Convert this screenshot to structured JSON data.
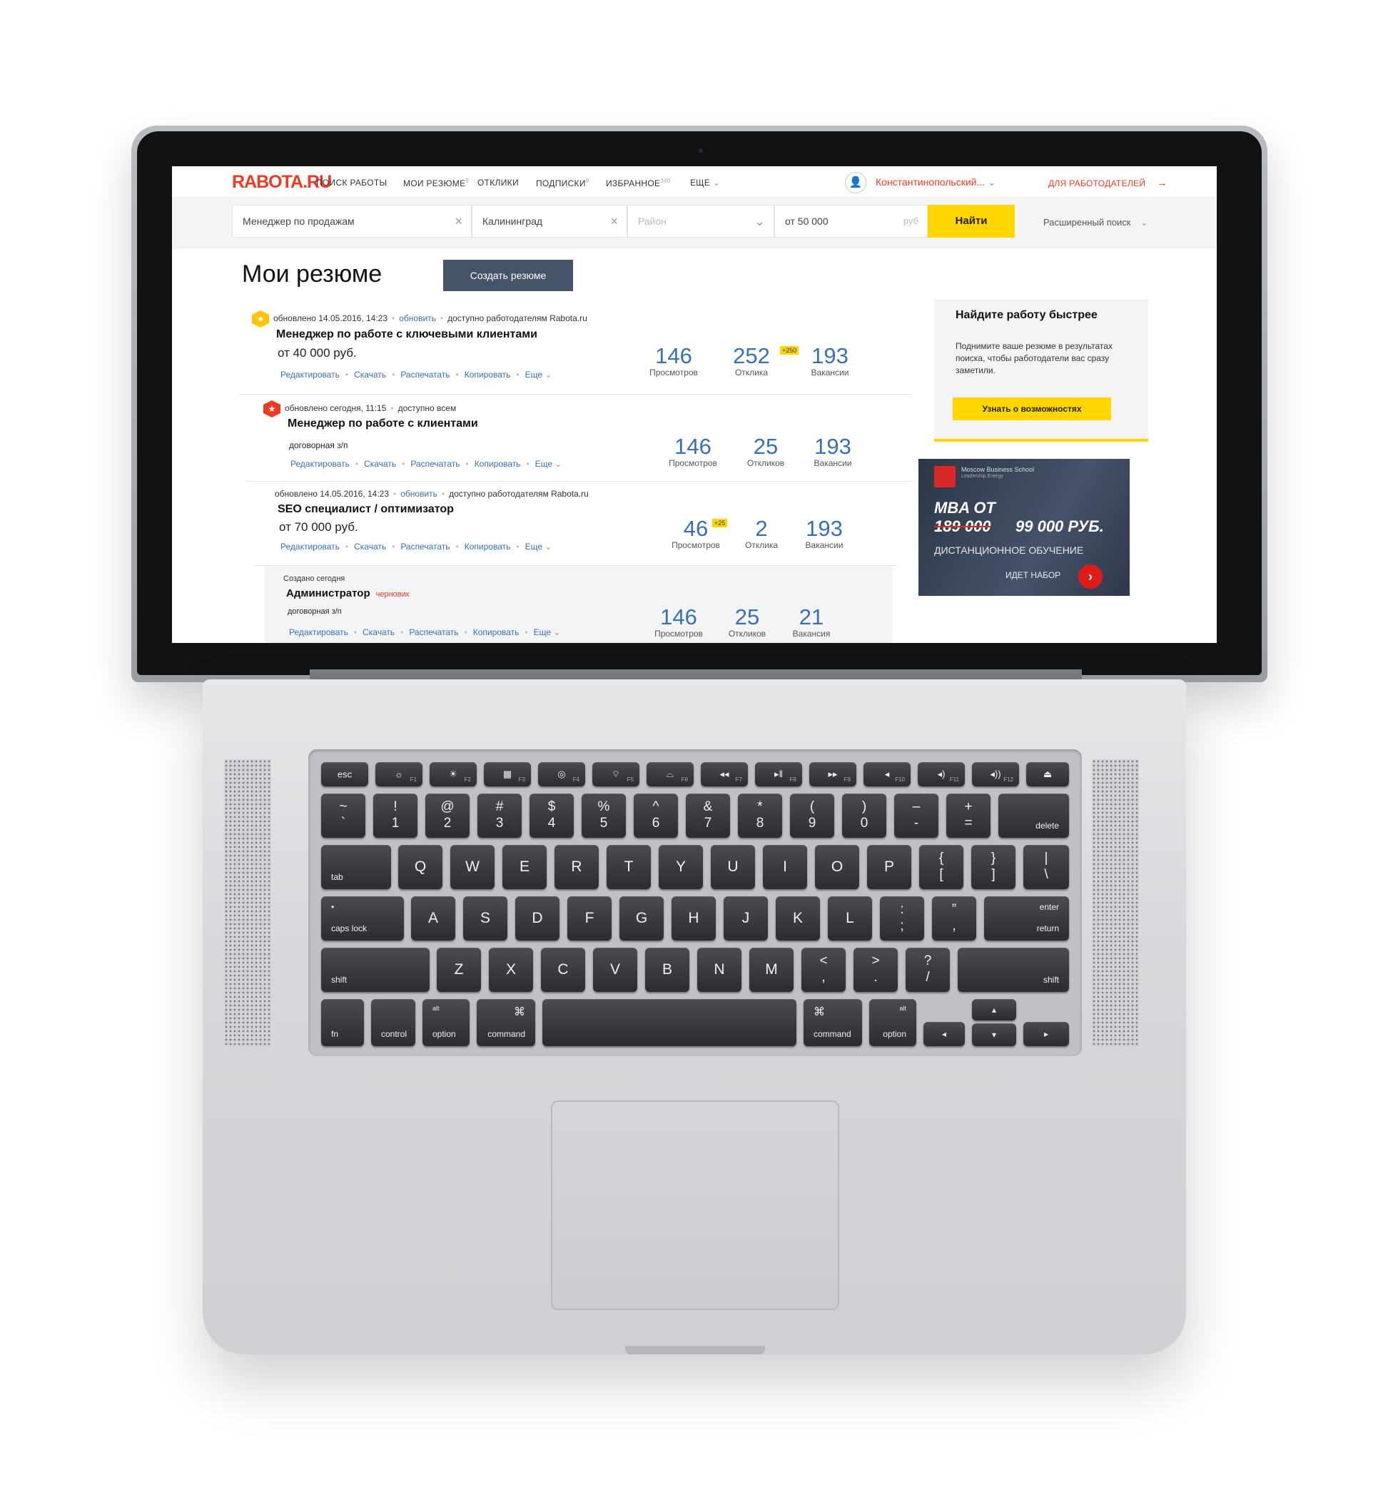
{
  "site": {
    "logo": "RABOTA.RU",
    "nav": [
      {
        "label": "ПОИСК РАБОТЫ",
        "count": ""
      },
      {
        "label": "МОИ РЕЗЮМЕ",
        "count": "9"
      },
      {
        "label": "ОТКЛИКИ",
        "count": ""
      },
      {
        "label": "ПОДПИСКИ",
        "count": "9"
      },
      {
        "label": "ИЗБРАННОЕ",
        "count": "340"
      },
      {
        "label": "ЕЩЕ",
        "count": ""
      }
    ],
    "user_name": "Константинопольский...",
    "employers_link": "ДЛЯ РАБОТОДАТЕЛЕЙ"
  },
  "search": {
    "query": "Менеджер по продажам",
    "city": "Калининград",
    "district_placeholder": "Район",
    "salary_from": "от 50 000",
    "currency": "руб",
    "find_button": "Найти",
    "advanced": "Расширенный поиск"
  },
  "page": {
    "title": "Мои резюме",
    "create_button": "Создать резюме"
  },
  "action_labels": [
    "Редактировать",
    "Скачать",
    "Распечатать",
    "Копировать",
    "Еще"
  ],
  "resumes": [
    {
      "status": "обновлено 14.05.2016, 14:23",
      "refresh": "обновить",
      "visibility": "доступно работодателям Rabota.ru",
      "title": "Менеджер по работе с ключевыми клиентами",
      "salary": "от 40 000 руб.",
      "stats": [
        {
          "value": "146",
          "label": "Просмотров",
          "badge": ""
        },
        {
          "value": "252",
          "label": "Отклика",
          "badge": "+250"
        },
        {
          "value": "193",
          "label": "Вакансии",
          "badge": ""
        }
      ]
    },
    {
      "status": "обновлено сегодня, 11:15",
      "refresh": "",
      "visibility": "доступно всем",
      "title": "Менеджер по работе с клиентами",
      "salary": "договорная з/п",
      "stats": [
        {
          "value": "146",
          "label": "Просмотров",
          "badge": ""
        },
        {
          "value": "25",
          "label": "Откликов",
          "badge": ""
        },
        {
          "value": "193",
          "label": "Вакансии",
          "badge": ""
        }
      ]
    },
    {
      "status": "обновлено 14.05.2016, 14:23",
      "refresh": "обновить",
      "visibility": "доступно работодателям Rabota.ru",
      "title": "SEO специалист / оптимизатор",
      "salary": "от 70 000 руб.",
      "stats": [
        {
          "value": "46",
          "label": "Просмотров",
          "badge": "+25"
        },
        {
          "value": "2",
          "label": "Отклика",
          "badge": ""
        },
        {
          "value": "193",
          "label": "Вакансии",
          "badge": ""
        }
      ]
    },
    {
      "status": "Создано сегодня",
      "refresh": "",
      "visibility": "",
      "title": "Администратор",
      "draft": "черновик",
      "salary": "договорная з/п",
      "stats": [
        {
          "value": "146",
          "label": "Просмотров",
          "badge": ""
        },
        {
          "value": "25",
          "label": "Откликов",
          "badge": ""
        },
        {
          "value": "21",
          "label": "Вакансия",
          "badge": ""
        }
      ]
    }
  ],
  "promo": {
    "title": "Найдите работу быстрее",
    "text": "Поднимите ваше резюме в результатах поиска, чтобы работодатели вас сразу заметили.",
    "button": "Узнать о возможностях"
  },
  "ad": {
    "brand": "Moscow Business School",
    "brand_tag": "Leadership Energy",
    "line1": "MBA ОТ",
    "old_price": "189 000",
    "new_price": "99 000 РУБ.",
    "subtitle": "ДИСТАНЦИОННОЕ ОБУЧЕНИЕ",
    "cta": "ИДЕТ НАБОР"
  },
  "keyboard": {
    "fn_row": [
      {
        "icon": "esc",
        "f": ""
      },
      {
        "icon": "☼",
        "f": "F1"
      },
      {
        "icon": "☀",
        "f": "F2"
      },
      {
        "icon": "▦",
        "f": "F3"
      },
      {
        "icon": "◎",
        "f": "F4"
      },
      {
        "icon": "⌔",
        "f": "F5"
      },
      {
        "icon": "⌓",
        "f": "F6"
      },
      {
        "icon": "◂◂",
        "f": "F7"
      },
      {
        "icon": "▸‖",
        "f": "F8"
      },
      {
        "icon": "▸▸",
        "f": "F9"
      },
      {
        "icon": "◂",
        "f": "F10"
      },
      {
        "icon": "◂)",
        "f": "F11"
      },
      {
        "icon": "◂))",
        "f": "F12"
      },
      {
        "icon": "⏏",
        "f": ""
      }
    ],
    "num_row": [
      [
        "~",
        "`"
      ],
      [
        "!",
        "1"
      ],
      [
        "@",
        "2"
      ],
      [
        "#",
        "3"
      ],
      [
        "$",
        "4"
      ],
      [
        "%",
        "5"
      ],
      [
        "^",
        "6"
      ],
      [
        "&",
        "7"
      ],
      [
        "*",
        "8"
      ],
      [
        "(",
        "9"
      ],
      [
        ")",
        "0"
      ],
      [
        "–",
        "-"
      ],
      [
        "+",
        "="
      ]
    ],
    "delete": "delete",
    "tab": "tab",
    "q_row": [
      "Q",
      "W",
      "E",
      "R",
      "T",
      "Y",
      "U",
      "I",
      "O",
      "P"
    ],
    "q_row_extra": [
      [
        "{",
        "["
      ],
      [
        "}",
        "]"
      ],
      [
        "|",
        "\\"
      ]
    ],
    "caps": "caps lock",
    "a_row": [
      "A",
      "S",
      "D",
      "F",
      "G",
      "H",
      "J",
      "K",
      "L"
    ],
    "a_row_extra": [
      [
        ":",
        ";"
      ],
      [
        "”",
        ","
      ]
    ],
    "enter": "enter",
    "return": "return",
    "shift": "shift",
    "z_row": [
      "Z",
      "X",
      "C",
      "V",
      "B",
      "N",
      "M"
    ],
    "z_row_extra": [
      [
        "<",
        ","
      ],
      [
        ">",
        "."
      ],
      [
        "?",
        "/"
      ]
    ],
    "fn": "fn",
    "control": "control",
    "alt": "alt",
    "option": "option",
    "command": "command",
    "cmd_symbol": "⌘",
    "arrows": [
      "◂",
      "▴",
      "▾",
      "▸"
    ]
  }
}
